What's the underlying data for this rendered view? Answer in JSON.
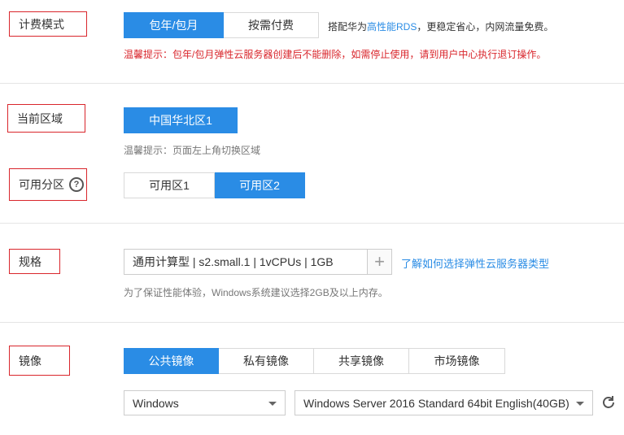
{
  "billing": {
    "label": "计费模式",
    "options": [
      "包年/包月",
      "按需付费"
    ],
    "selected": 0,
    "note_prefix": "搭配华为",
    "note_link": "高性能RDS",
    "note_suffix": "，更稳定省心，内网流量免费。",
    "warning": "温馨提示：包年/包月弹性云服务器创建后不能删除，如需停止使用，请到用户中心执行退订操作。"
  },
  "region": {
    "label": "当前区域",
    "value": "中国华北区1",
    "hint": "温馨提示：页面左上角切换区域"
  },
  "zone": {
    "label": "可用分区",
    "help_icon": "question-circle-icon",
    "options": [
      "可用区1",
      "可用区2"
    ],
    "selected": 1
  },
  "spec": {
    "label": "规格",
    "value": "通用计算型 | s2.small.1 | 1vCPUs | 1GB",
    "add_icon": "plus-icon",
    "link": "了解如何选择弹性云服务器类型",
    "hint": "为了保证性能体验，Windows系统建议选择2GB及以上内存。"
  },
  "image": {
    "label": "镜像",
    "tabs": [
      "公共镜像",
      "私有镜像",
      "共享镜像",
      "市场镜像"
    ],
    "selected": 0,
    "os_select": "Windows",
    "version_select": "Windows Server 2016 Standard 64bit English(40GB)",
    "refresh_icon": "refresh-icon"
  },
  "colors": {
    "accent": "#2a8ce5",
    "warning": "#d9262c",
    "label_border": "#d9262c"
  }
}
